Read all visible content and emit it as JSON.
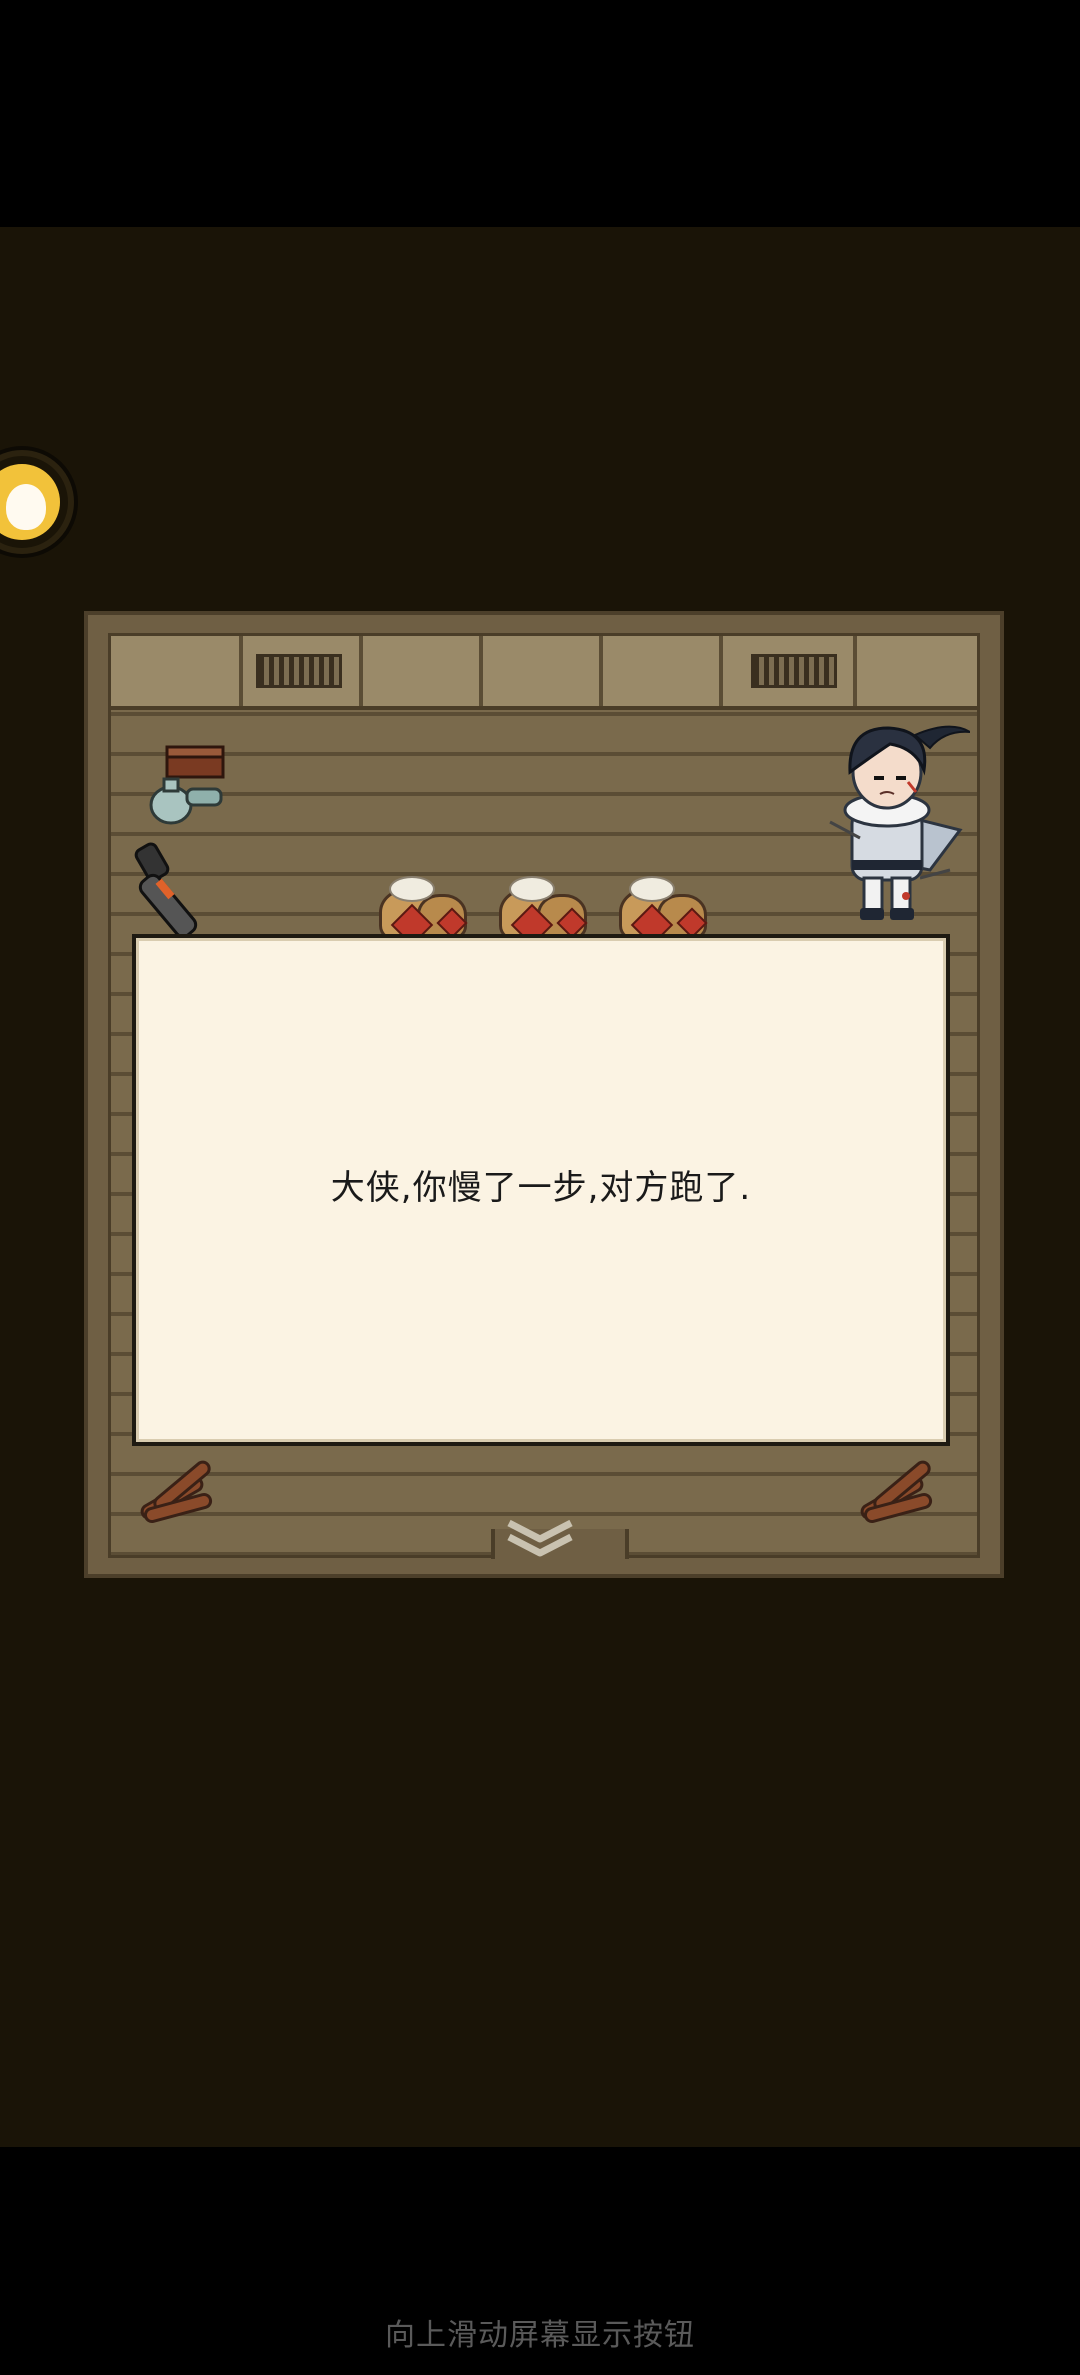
{
  "dialog": {
    "text": "大侠,你慢了一步,对方跑了."
  },
  "system": {
    "nav_hint": "向上滑动屏幕显示按钮"
  },
  "icons": {
    "avatar": "cat-avatar-icon",
    "continue": "chevron-down-icon"
  },
  "colors": {
    "background": "#1a1407",
    "dialog_bg": "#fbf3e3",
    "floor": "#7a6a4c"
  }
}
